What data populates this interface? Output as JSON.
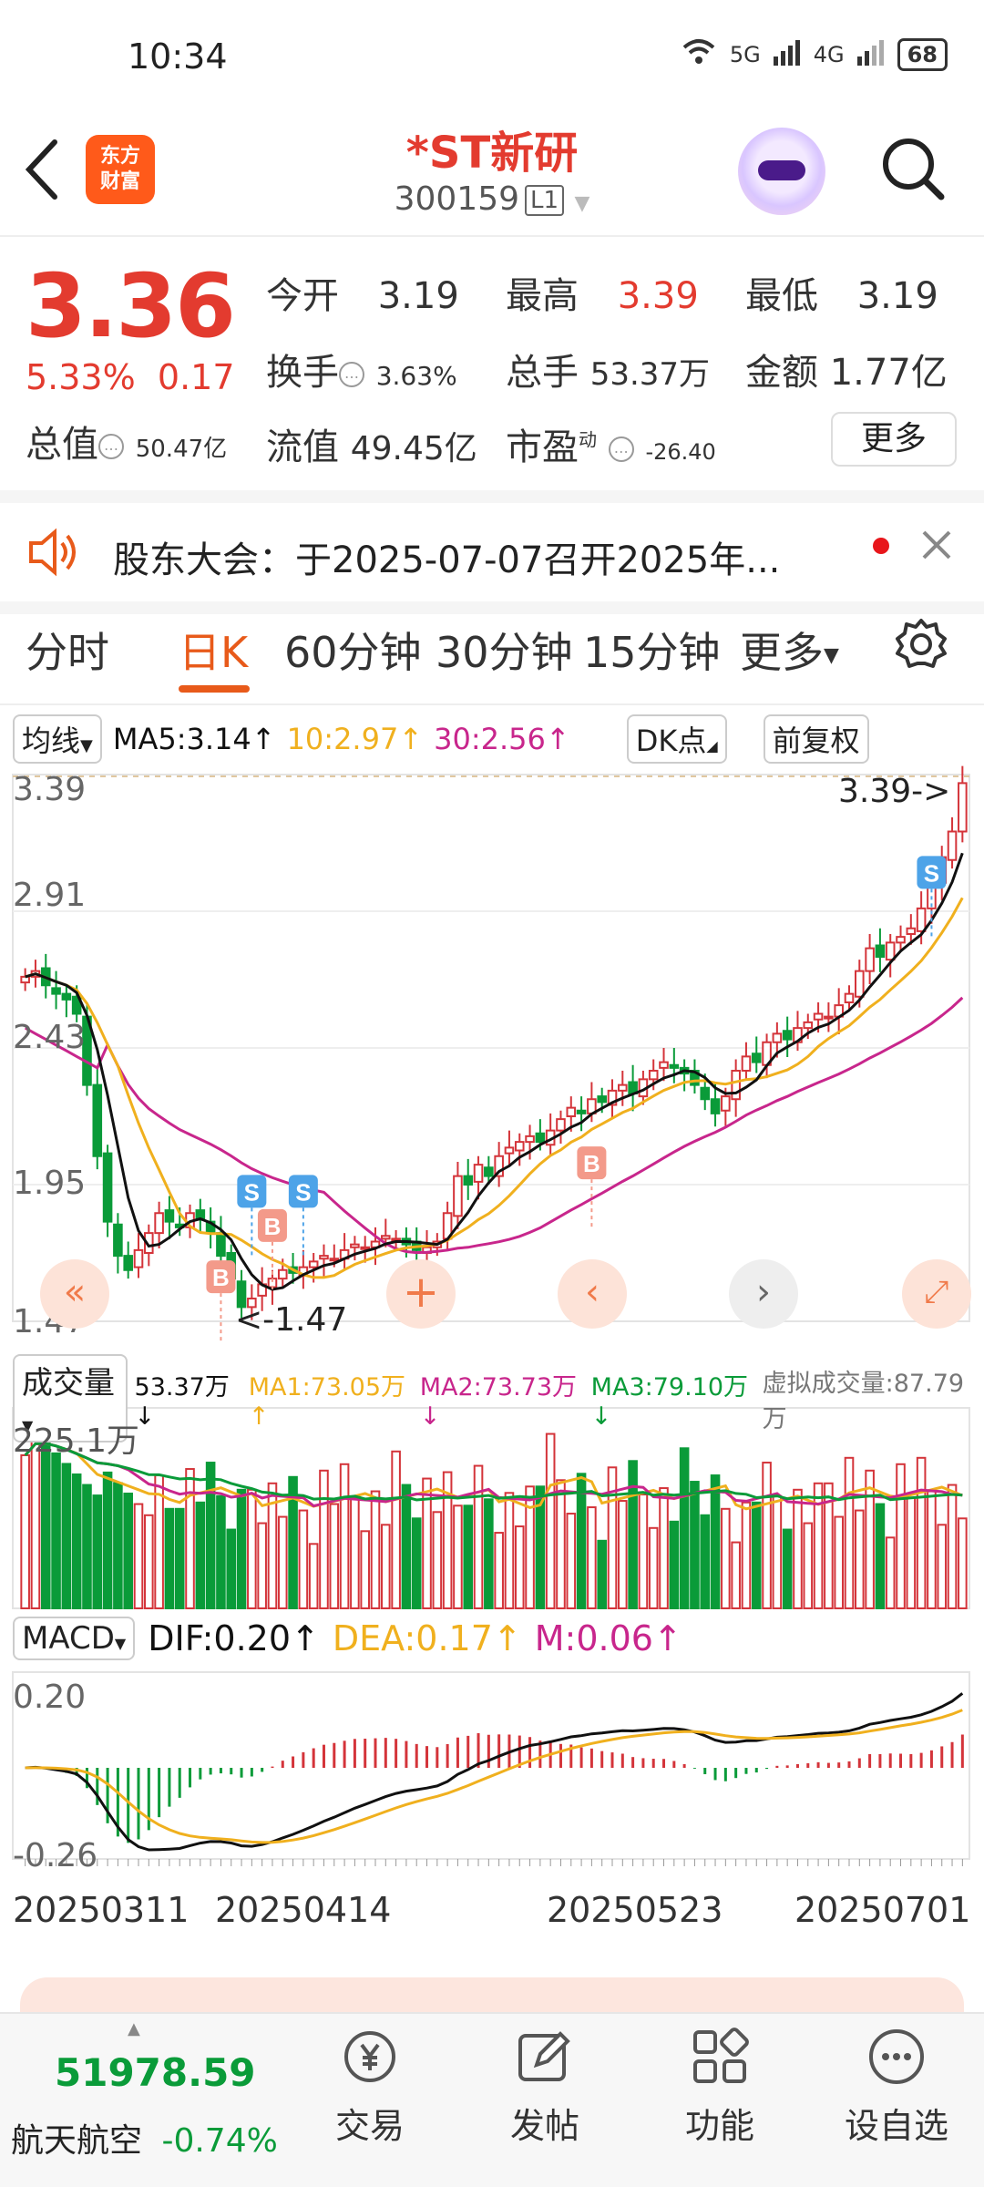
{
  "status_bar": {
    "time": "10:34",
    "net1": "5G",
    "net2": "4G",
    "battery": "68"
  },
  "header": {
    "logo_line1": "东方",
    "logo_line2": "财富",
    "title": "*ST新研",
    "code": "300159",
    "level": "L1"
  },
  "quote": {
    "price": "3.36",
    "change_pct": "5.33%",
    "change": "0.17",
    "open_label": "今开",
    "open": "3.19",
    "high_label": "最高",
    "high": "3.39",
    "low_label": "最低",
    "low": "3.19",
    "turnover_label": "换手",
    "turnover": "3.63%",
    "volume_label": "总手",
    "volume": "53.37万",
    "amount_label": "金额",
    "amount": "1.77亿",
    "mktcap_label": "总值",
    "mktcap": "50.47亿",
    "float_label": "流值",
    "float": "49.45亿",
    "pe_label": "市盈",
    "pe_sup": "动",
    "pe": "-26.40",
    "more_label": "更多"
  },
  "notice": {
    "text": "股东大会：于2025-07-07召开2025年..."
  },
  "tabs": [
    "分时",
    "日K",
    "60分钟",
    "30分钟",
    "15分钟",
    "更多"
  ],
  "ma_bar": {
    "type_label": "均线",
    "ma5": "MA5:3.14↑",
    "ma10": "10:2.97↑",
    "ma30": "30:2.56↑",
    "dk_label": "DK点",
    "fq_label": "前复权"
  },
  "vol_bar": {
    "label": "成交量",
    "v": "53.37万↓",
    "ma1": "MA1:73.05万↑",
    "ma2": "MA2:73.73万↓",
    "ma3": "MA3:79.10万↓",
    "virtual": "虚拟成交量:87.79万"
  },
  "macd_bar": {
    "label": "MACD",
    "dif": "DIF:0.20↑",
    "dea": "DEA:0.17↑",
    "m": "M:0.06↑"
  },
  "chart_data": {
    "type": "candlestick",
    "price_ticks": [
      "3.39",
      "2.91",
      "2.43",
      "1.95",
      "1.47"
    ],
    "price_range": [
      1.47,
      3.39
    ],
    "high_marker": "3.39->",
    "low_marker": "<-1.47",
    "volume_tick": "225.1万",
    "macd_ticks": [
      "0.20",
      "-0.26"
    ],
    "dates": [
      "20250311",
      "20250414",
      "20250523",
      "20250701"
    ],
    "signals": [
      "B",
      "S",
      "B",
      "S",
      "B",
      "S"
    ],
    "colors": {
      "up": "#d4343a",
      "down": "#0a9b39",
      "ma5": "#111111",
      "ma10": "#f0b01e",
      "ma30": "#c8268c"
    },
    "closes": [
      2.68,
      2.7,
      2.65,
      2.62,
      2.6,
      2.55,
      2.3,
      2.05,
      1.82,
      1.7,
      1.65,
      1.72,
      1.78,
      1.85,
      1.82,
      1.8,
      1.85,
      1.83,
      1.78,
      1.7,
      1.62,
      1.52,
      1.55,
      1.6,
      1.62,
      1.65,
      1.64,
      1.66,
      1.68,
      1.7,
      1.69,
      1.72,
      1.74,
      1.73,
      1.75,
      1.77,
      1.76,
      1.74,
      1.72,
      1.73,
      1.75,
      1.85,
      1.98,
      1.95,
      2.02,
      1.98,
      2.05,
      2.08,
      2.1,
      2.12,
      2.1,
      2.14,
      2.18,
      2.22,
      2.2,
      2.25,
      2.24,
      2.28,
      2.3,
      2.27,
      2.32,
      2.35,
      2.38,
      2.36,
      2.34,
      2.3,
      2.25,
      2.2,
      2.26,
      2.35,
      2.4,
      2.38,
      2.45,
      2.48,
      2.46,
      2.5,
      2.52,
      2.55,
      2.54,
      2.58,
      2.62,
      2.7,
      2.78,
      2.75,
      2.8,
      2.82,
      2.85,
      2.92,
      3.0,
      3.1,
      3.19,
      3.36
    ]
  },
  "bottom_bar": {
    "index_value": "51978.59",
    "index_name": "航天航空",
    "index_change": "-0.74%",
    "items": [
      "交易",
      "发帖",
      "功能",
      "设自选"
    ]
  }
}
